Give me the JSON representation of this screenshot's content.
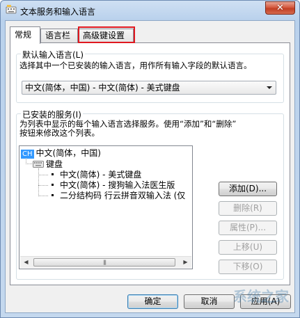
{
  "window": {
    "title": "文本服务和输入语言",
    "close_label": "✕"
  },
  "tabs": [
    {
      "label": "常规",
      "active": true
    },
    {
      "label": "语言栏",
      "active": false
    },
    {
      "label": "高级键设置",
      "active": false,
      "highlighted": true
    }
  ],
  "default_lang": {
    "label": "默认输入语言(L)",
    "desc": "选择其中一个已安装的输入语言，用作所有输入字段的默认语言。",
    "selected": "中文(简体，中国) - 中文(简体) - 美式键盘"
  },
  "services": {
    "label": "已安装的服务(I)",
    "desc1": "为列表中显示的每个输入语言选择服务。使用“添加”和“删除”",
    "desc2": "按钮来修改这个列表。",
    "tree": {
      "lang_badge": "CH",
      "lang_name": "中文(简体，中国)",
      "group_name": "键盘",
      "items": [
        "中文(简体) - 美式键盘",
        "中文(简体) - 搜狗输入法医生版",
        "二分结构码 行云拼音双输入法 (仅"
      ]
    },
    "buttons": {
      "add": "添加(D)...",
      "remove": "删除(R)",
      "properties": "属性(P)...",
      "move_up": "上移(U)",
      "move_down": "下移(O)"
    }
  },
  "footer": {
    "ok": "确定",
    "cancel": "取消",
    "apply": "应用(A)"
  },
  "watermark": "系统之家",
  "colors": {
    "highlight_box": "#e0181f",
    "lang_badge_bg": "#3399ff",
    "close_button": "#c13f24"
  },
  "icons": {
    "app": "text-services-icon",
    "keyboard": "keyboard-icon",
    "scroll_left": "arrow-left-icon",
    "scroll_right": "arrow-right-icon"
  }
}
